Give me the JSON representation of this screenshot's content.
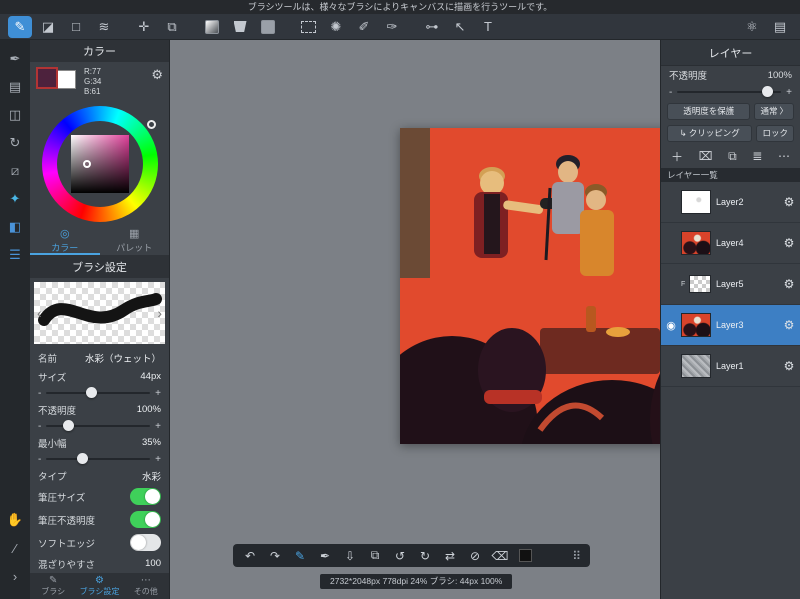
{
  "top_bar": {
    "message": "ブラシツールは、様々なブラシによりキャンバスに描画を行うツールです。"
  },
  "ui": {
    "gear": "⚙",
    "eye": "◉",
    "minus": "-",
    "plus": "+",
    "clip_icon": "↳"
  },
  "toolbar": {
    "tools": [
      {
        "name": "pen-tool",
        "glyph": "✎"
      },
      {
        "name": "eraser-tool",
        "glyph": "◪"
      },
      {
        "name": "shape-tool",
        "glyph": "□"
      },
      {
        "name": "pattern-brush-tool",
        "glyph": "≋"
      },
      {
        "name": "move-tool",
        "glyph": "✛"
      },
      {
        "name": "transform-tool",
        "glyph": "⧉"
      },
      {
        "name": "gradient-tool",
        "glyph": ""
      },
      {
        "name": "bucket-tool",
        "glyph": ""
      },
      {
        "name": "fill-solid-tool",
        "glyph": ""
      },
      {
        "name": "select-rect-tool",
        "glyph": ""
      },
      {
        "name": "magic-wand-tool",
        "glyph": "✺"
      },
      {
        "name": "select-pen-tool",
        "glyph": "✐"
      },
      {
        "name": "select-eraser-tool",
        "glyph": "✑"
      },
      {
        "name": "snap-tool",
        "glyph": "⊶"
      },
      {
        "name": "select-move-tool",
        "glyph": "↖"
      },
      {
        "name": "text-tool",
        "glyph": "T"
      },
      {
        "name": "cloud-tool",
        "glyph": "⚛"
      },
      {
        "name": "panel-layout-tool",
        "glyph": "▤"
      }
    ]
  },
  "left_strip": {
    "icons": [
      {
        "name": "pen-nib-icon",
        "glyph": "✒"
      },
      {
        "name": "canvas-panel-icon",
        "glyph": "▤"
      },
      {
        "name": "select-panel-icon",
        "glyph": "◫"
      },
      {
        "name": "rotate-icon",
        "glyph": "↻"
      },
      {
        "name": "ruler-icon",
        "glyph": "⧄"
      },
      {
        "name": "airbrush-icon",
        "glyph": "✦"
      },
      {
        "name": "color-panel-icon",
        "glyph": "◧"
      },
      {
        "name": "list-panel-icon",
        "glyph": "☰"
      }
    ],
    "bottom": [
      {
        "name": "hand-icon",
        "glyph": "✋"
      },
      {
        "name": "eyedropper-icon",
        "glyph": "∕"
      },
      {
        "name": "chevron-icon",
        "glyph": "›"
      }
    ]
  },
  "color_panel": {
    "title": "カラー",
    "rgb": {
      "r": "R:77",
      "g": "G:34",
      "b": "B:61"
    },
    "tabs": [
      {
        "label": "カラー",
        "glyph": "◎"
      },
      {
        "label": "パレット",
        "glyph": "▦"
      }
    ],
    "current_color": "#4d223d",
    "secondary_color": "#ffffff"
  },
  "brush_panel": {
    "title": "ブラシ設定",
    "prev_arrow": "‹",
    "next_arrow": "›",
    "rows": {
      "name_label": "名前",
      "name_value": "水彩（ウェット）",
      "size_label": "サイズ",
      "size_value": "44px",
      "opacity_label": "不透明度",
      "opacity_value": "100%",
      "min_width_label": "最小幅",
      "min_width_value": "35%",
      "type_label": "タイプ",
      "type_value": "水彩",
      "pressure_size_label": "筆圧サイズ",
      "pressure_opacity_label": "筆圧不透明度",
      "soft_edge_label": "ソフトエッジ",
      "mixing_label": "混ざりやすさ",
      "mixing_value": "100"
    },
    "toggles": {
      "pressure_size": true,
      "pressure_opacity": true,
      "soft_edge": false
    },
    "bottom_tabs": [
      {
        "label": "ブラシ",
        "glyph": "✎"
      },
      {
        "label": "ブラシ設定",
        "glyph": "⚙"
      },
      {
        "label": "その他",
        "glyph": "⋯"
      }
    ]
  },
  "layer_panel": {
    "title": "レイヤー",
    "opacity_label": "不透明度",
    "opacity_value": "100%",
    "protect_button": "透明度を保護",
    "blend_button": "通常",
    "blend_chevron": "〉",
    "clipping_button": "クリッピング",
    "lock_button": "ロック",
    "toolbar": [
      {
        "name": "add-layer-button",
        "glyph": "＋"
      },
      {
        "name": "delete-layer-button",
        "glyph": "⌧"
      },
      {
        "name": "duplicate-layer-button",
        "glyph": "⧉"
      },
      {
        "name": "merge-layer-button",
        "glyph": "≣"
      },
      {
        "name": "more-layer-button",
        "glyph": "⋯"
      }
    ],
    "list_label": "レイヤー一覧",
    "layers": [
      {
        "name": "Layer2",
        "selected": false
      },
      {
        "name": "Layer4",
        "selected": false
      },
      {
        "name": "Layer5",
        "badge": "F",
        "selected": false
      },
      {
        "name": "Layer3",
        "selected": true,
        "visible": true
      },
      {
        "name": "Layer1",
        "selected": false
      }
    ]
  },
  "bottom_toolbar": {
    "buttons": [
      {
        "name": "undo-button",
        "glyph": "↶"
      },
      {
        "name": "redo-button",
        "glyph": "↷"
      },
      {
        "name": "brush-mode-button",
        "glyph": "✎"
      },
      {
        "name": "eyedropper-button",
        "glyph": "✒"
      },
      {
        "name": "save-button",
        "glyph": "⇩"
      },
      {
        "name": "export-button",
        "glyph": "⧉"
      },
      {
        "name": "rotate-ccw-button",
        "glyph": "↺"
      },
      {
        "name": "rotate-cw-button",
        "glyph": "↻"
      },
      {
        "name": "flip-button",
        "glyph": "⇄"
      },
      {
        "name": "snap-off-button",
        "glyph": "⊘"
      },
      {
        "name": "clear-button",
        "glyph": "⌫"
      },
      {
        "name": "drag-handle",
        "glyph": "⠿"
      }
    ]
  },
  "status_bar": {
    "text": "2732*2048px 778dpi 24% ブラシ: 44px 100%"
  },
  "colors": {
    "accent": "#3f8fd6",
    "toggle_on": "#3fd05a",
    "canvas_bg": "#e14a2d",
    "selected_layer": "#3d7fc4"
  }
}
